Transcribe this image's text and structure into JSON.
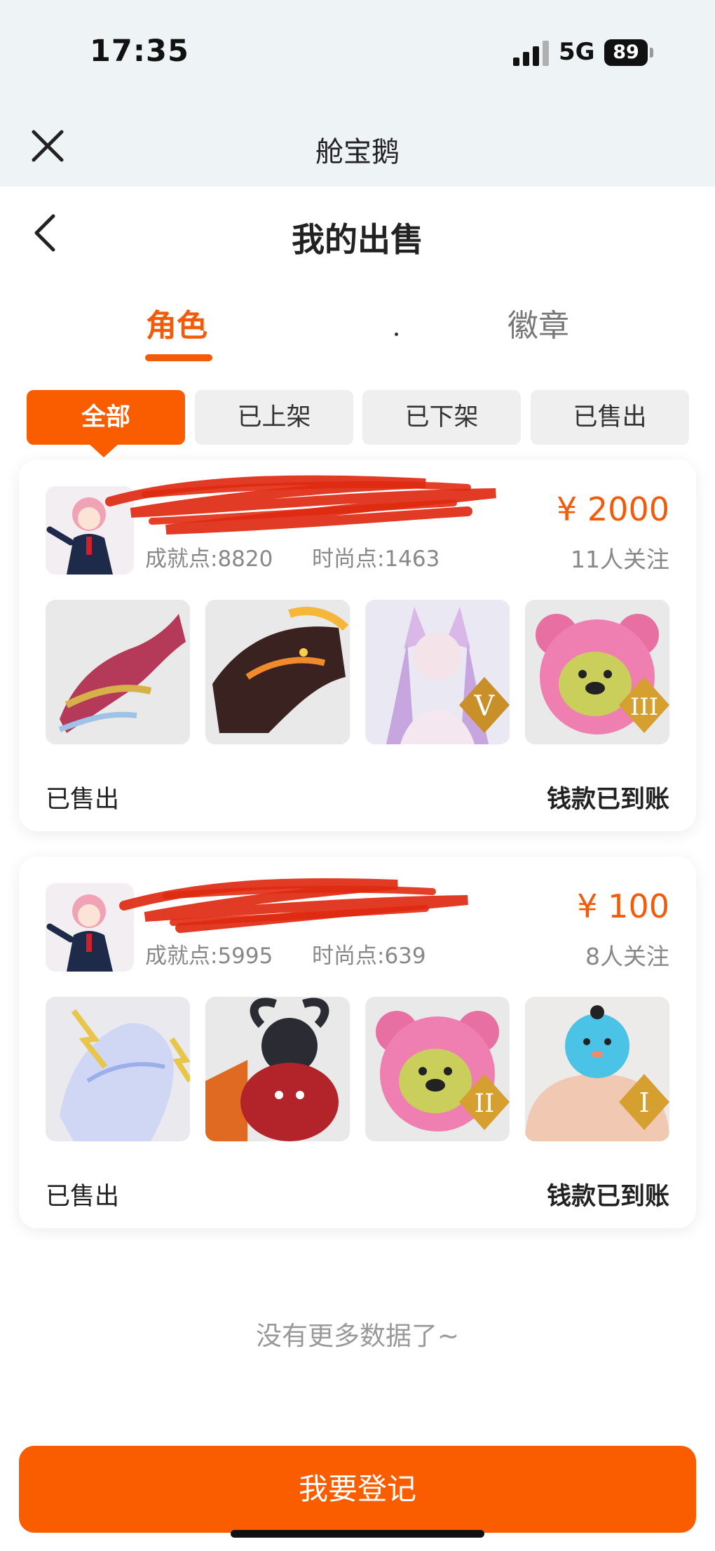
{
  "status_bar": {
    "time": "17:35",
    "network": "5G",
    "battery": "89"
  },
  "app": {
    "title": "舱宝鹅"
  },
  "page": {
    "title": "我的出售"
  },
  "tabs": [
    {
      "label": "角色",
      "active": true
    },
    {
      "label": "徽章",
      "active": false
    }
  ],
  "filters": [
    {
      "label": "全部",
      "active": true
    },
    {
      "label": "已上架",
      "active": false
    },
    {
      "label": "已下架",
      "active": false
    },
    {
      "label": "已售出",
      "active": false
    }
  ],
  "listings": [
    {
      "achievement": "成就点:8820",
      "fashion": "时尚点:1463",
      "price": "¥ 2000",
      "watchers": "11人关注",
      "status": "已售出",
      "payout": "钱款已到账",
      "items": [
        {
          "icon": "dragon-mount-icon"
        },
        {
          "icon": "fire-dragon-mount-icon"
        },
        {
          "icon": "fox-costume-icon",
          "badge": "V"
        },
        {
          "icon": "pink-bear-costume-icon",
          "badge": "III"
        }
      ]
    },
    {
      "achievement": "成就点:5995",
      "fashion": "时尚点:639",
      "price": "¥ 100",
      "watchers": "8人关注",
      "status": "已售出",
      "payout": "钱款已到账",
      "items": [
        {
          "icon": "lightning-horse-icon"
        },
        {
          "icon": "red-beast-icon"
        },
        {
          "icon": "pink-bear-costume-icon",
          "badge": "II"
        },
        {
          "icon": "bird-muscle-costume-icon",
          "badge": "I"
        }
      ]
    }
  ],
  "footer": {
    "no_more": "没有更多数据了~",
    "register": "我要登记"
  },
  "colors": {
    "accent": "#fa5c00",
    "price": "#f25b0a",
    "header_bg": "#eef3f6"
  }
}
